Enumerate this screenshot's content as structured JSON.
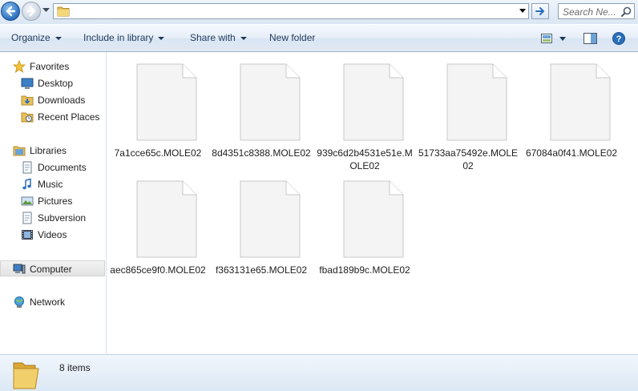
{
  "address_bar": {
    "path": "",
    "search_placeholder": "Search Ne..."
  },
  "toolbar": {
    "organize": "Organize",
    "include_in_library": "Include in library",
    "share_with": "Share with",
    "new_folder": "New folder"
  },
  "nav": {
    "favorites": "Favorites",
    "desktop": "Desktop",
    "downloads": "Downloads",
    "recent_places": "Recent Places",
    "libraries": "Libraries",
    "documents": "Documents",
    "music": "Music",
    "pictures": "Pictures",
    "subversion": "Subversion",
    "videos": "Videos",
    "computer": "Computer",
    "network": "Network"
  },
  "files": [
    {
      "name": "7a1cce65c.MOLE02"
    },
    {
      "name": "8d4351c8388.MOLE02"
    },
    {
      "name": "939c6d2b4531e51e.MOLE02"
    },
    {
      "name": "51733aa75492e.MOLE02"
    },
    {
      "name": "67084a0f41.MOLE02"
    },
    {
      "name": "aec865ce9f0.MOLE02"
    },
    {
      "name": "f363131e65.MOLE02"
    },
    {
      "name": "fbad189b9c.MOLE02"
    }
  ],
  "details": {
    "item_count": "8 items"
  },
  "colors": {
    "accent": "#2a6ebd",
    "folder": "#e8c15a"
  }
}
